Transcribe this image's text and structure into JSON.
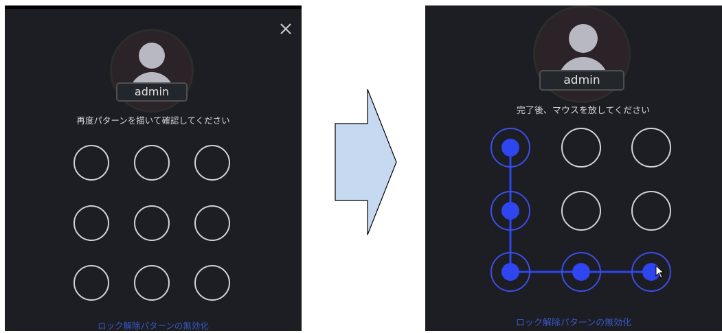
{
  "before": {
    "username": "admin",
    "prompt": "再度パターンを描いて確認してください",
    "disable_link": "ロック解除パターンの無効化",
    "close": "×",
    "pattern_nodes": [
      {
        "label": "node-1",
        "active": false
      },
      {
        "label": "node-2",
        "active": false
      },
      {
        "label": "node-3",
        "active": false
      },
      {
        "label": "node-4",
        "active": false
      },
      {
        "label": "node-5",
        "active": false
      },
      {
        "label": "node-6",
        "active": false
      },
      {
        "label": "node-7",
        "active": false
      },
      {
        "label": "node-8",
        "active": false
      },
      {
        "label": "node-9",
        "active": false
      }
    ]
  },
  "after": {
    "username": "admin",
    "prompt": "完了後、マウスを放してください",
    "disable_link": "ロック解除パターンの無効化",
    "pattern_nodes": [
      {
        "label": "node-1",
        "active": true
      },
      {
        "label": "node-2",
        "active": false
      },
      {
        "label": "node-3",
        "active": false
      },
      {
        "label": "node-4",
        "active": true
      },
      {
        "label": "node-5",
        "active": false
      },
      {
        "label": "node-6",
        "active": false
      },
      {
        "label": "node-7",
        "active": true
      },
      {
        "label": "node-8",
        "active": true
      },
      {
        "label": "node-9",
        "active": true
      }
    ],
    "drawn_sequence": [
      1,
      4,
      7,
      8,
      9
    ]
  },
  "transition_arrow": {
    "color": "#c6d9f1",
    "outline": "#000000",
    "icon": "arrow-right-icon"
  },
  "colors": {
    "panel_bg": "#1c1e24",
    "accent": "#2e45f0",
    "link": "#3b56c4",
    "ring_idle": "#d4d4d8"
  }
}
